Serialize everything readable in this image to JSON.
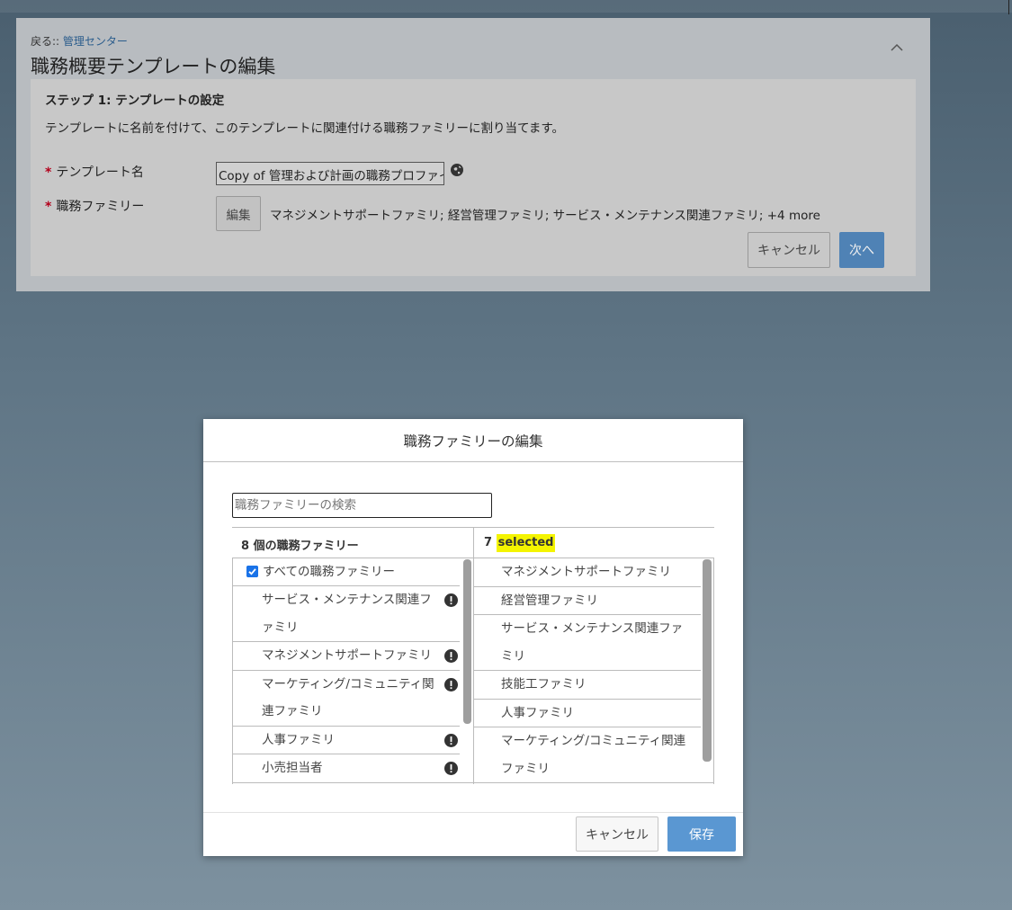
{
  "background_page": {
    "breadcrumb_prefix": "戻る::",
    "breadcrumb_link": "管理センター",
    "title": "職務概要テンプレートの編集",
    "step_title": "ステップ 1: テンプレートの設定",
    "step_description": "テンプレートに名前を付けて、このテンプレートに関連付ける職務ファミリーに割り当てます。",
    "required_marker": "*",
    "template_name_label": "テンプレート名",
    "template_name_value": "Copy of 管理および計画の職務プロファイル",
    "job_family_label": "職務ファミリー",
    "edit_button": "編集",
    "job_family_summary": "マネジメントサポートファミリ; 経営管理ファミリ; サービス・メンテナンス関連ファミリ; +4 more",
    "cancel_button": "キャンセル",
    "next_button": "次へ"
  },
  "dialog": {
    "title": "職務ファミリーの編集",
    "search_placeholder": "職務ファミリーの検索",
    "available_header": "8 個の職務ファミリー",
    "selected_count": "7",
    "selected_word": "selected",
    "select_all_label": "すべての職務ファミリー",
    "available_items": [
      "サービス・メンテナンス関連ファミリ",
      "マネジメントサポートファミリ",
      "マーケティング/コミュニティ関連ファミリ",
      "人事ファミリ",
      "小売担当者"
    ],
    "selected_items": [
      "マネジメントサポートファミリ",
      "経営管理ファミリ",
      "サービス・メンテナンス関連ファミリ",
      "技能工ファミリ",
      "人事ファミリ",
      "マーケティング/コミュニティ関連ファミリ"
    ],
    "cancel_button": "キャンセル",
    "save_button": "保存"
  },
  "icons": {
    "collapse": "chevron-up-icon",
    "globe": "globe-icon",
    "warning": "exclamation-circle-icon",
    "checkbox": "checkbox-checked-icon"
  },
  "colors": {
    "primary_button": "#5a97d2",
    "highlight": "#f4f400",
    "checkbox": "#1a73e8",
    "required": "#b3001b"
  }
}
